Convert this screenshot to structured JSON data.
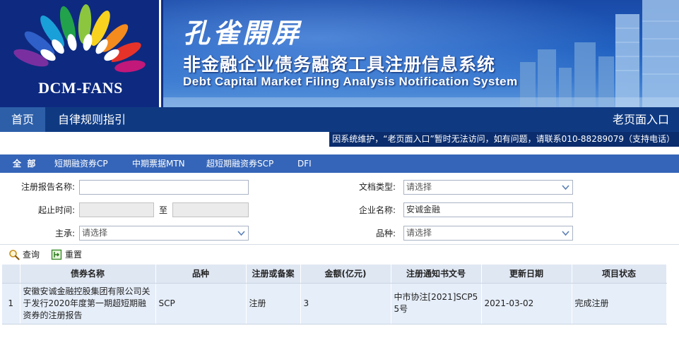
{
  "banner": {
    "logo_text": "DCM-FANS",
    "calligraphy": "孔雀開屏",
    "title_cn": "非金融企业债务融资工具注册信息系统",
    "title_en": "Debt Capital Market Filing Analysis Notification System"
  },
  "nav": {
    "home": "首页",
    "rules": "自律规则指引",
    "old_portal": "老页面入口"
  },
  "notice": "因系统维护，“老页面入口”暂时无法访问，如有问题，请联系010-88289079（支持电话）",
  "categories": [
    "全  部",
    "短期融资券CP",
    "中期票据MTN",
    "超短期融资券SCP",
    "DFI"
  ],
  "form": {
    "report_name_label": "注册报告名称:",
    "report_name_value": "",
    "doc_type_label": "文档类型:",
    "doc_type_value": "请选择",
    "time_label": "起止时间:",
    "time_sep": "至",
    "company_label": "企业名称:",
    "company_value": "安诚金融",
    "underwriter_label": "主承:",
    "underwriter_value": "请选择",
    "variety_label": "品种:",
    "variety_value": "请选择"
  },
  "actions": {
    "query": "查询",
    "reset": "重置"
  },
  "table": {
    "headers": [
      "",
      "债券名称",
      "品种",
      "注册或备案",
      "金额(亿元)",
      "注册通知书文号",
      "更新日期",
      "项目状态"
    ],
    "rows": [
      {
        "idx": "1",
        "name": "安徽安诚金融控股集团有限公司关于发行2020年度第一期超短期融资券的注册报告",
        "variety": "SCP",
        "type": "注册",
        "amount": "3",
        "notice_no": "中市协注[2021]SCP55号",
        "date": "2021-03-02",
        "status": "完成注册"
      }
    ]
  }
}
